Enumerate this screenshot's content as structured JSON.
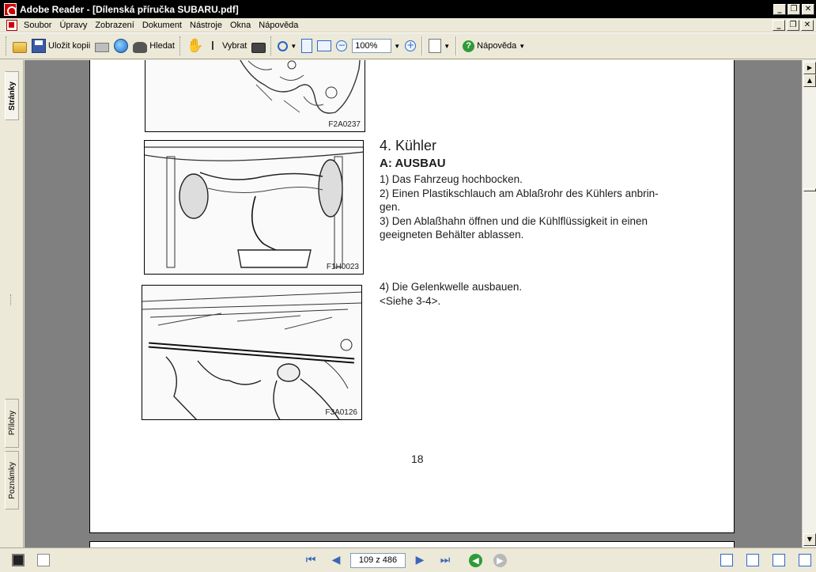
{
  "window": {
    "title": "Adobe Reader - [Dílenská příručka SUBARU.pdf]",
    "controls": [
      "_",
      "❐",
      "✕"
    ]
  },
  "menu": {
    "items": [
      "Soubor",
      "Úpravy",
      "Zobrazení",
      "Dokument",
      "Nástroje",
      "Okna",
      "Nápověda"
    ]
  },
  "toolbar": {
    "save_copy_label": "Uložit kopii",
    "search_label": "Hledat",
    "select_label": "Vybrat",
    "zoom_value": "100%",
    "help_label": "Nápověda"
  },
  "left_panel": {
    "tabs": [
      "Stránky",
      "Přílohy",
      "Poznámky"
    ]
  },
  "document": {
    "figure_ids": [
      "F2A0237",
      "F1H0023",
      "F3A0126"
    ],
    "heading": "4. Kühler",
    "subheading": "A: AUSBAU",
    "steps": [
      "1) Das Fahrzeug hochbocken.",
      "2) Einen Plastikschlauch am Ablaßrohr des Kühlers anbrin-",
      "gen.",
      "3) Den Ablaßhahn öffnen und die Kühlflüssigkeit in einen",
      "geeigneten Behälter ablassen."
    ],
    "step4": [
      "4) Die Gelenkwelle ausbauen.",
      "<Siehe 3-4>."
    ],
    "page_number": "18"
  },
  "status": {
    "page_indicator": "109 z 486"
  }
}
